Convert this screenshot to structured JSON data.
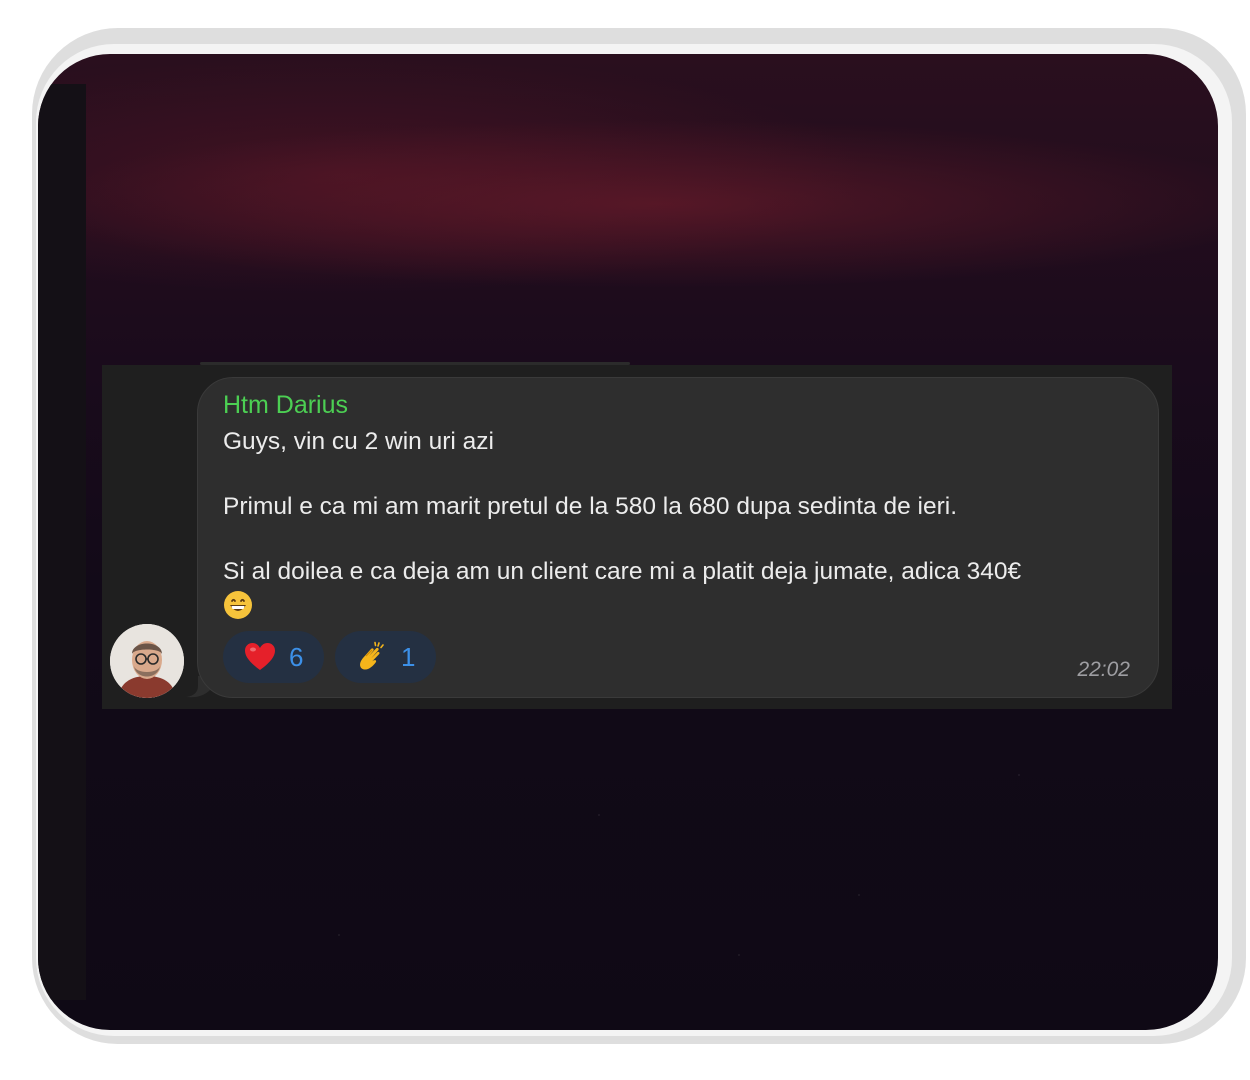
{
  "message": {
    "sender": "Htm Darius",
    "sender_color": "#4ccf53",
    "lines": [
      "Guys, vin cu 2 win uri azi",
      "Primul e ca mi am marit pretul de la 580 la 680 dupa sedinta de ieri.",
      "Si al doilea e ca deja am un client care mi a platit deja jumate, adica 340€"
    ],
    "trailing_emoji": "grinning-face-emoji",
    "time": "22:02"
  },
  "reactions": [
    {
      "icon": "heart-emoji",
      "count": "6"
    },
    {
      "icon": "clapping-hands-emoji",
      "count": "1"
    }
  ],
  "colors": {
    "bubble": "#2e2e2e",
    "reaction_pill": "#243042",
    "reaction_count": "#3c90e8",
    "background_top": "#2a0f1e",
    "background_bottom": "#0f0915"
  }
}
